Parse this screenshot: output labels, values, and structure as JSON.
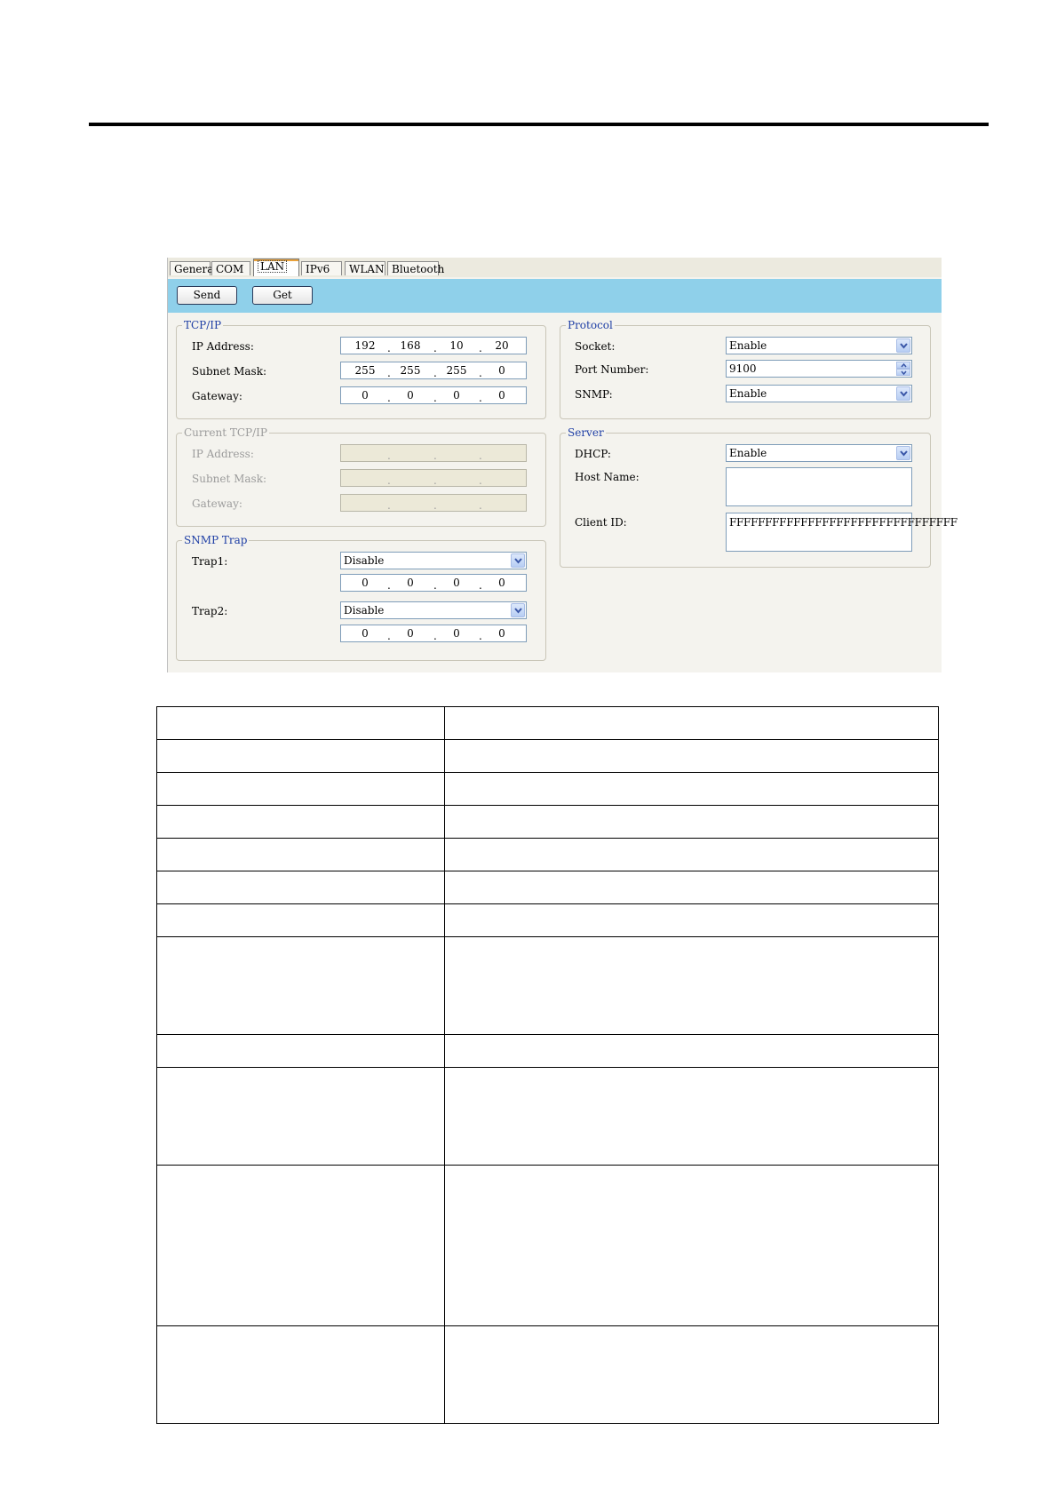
{
  "tabs": [
    {
      "label": "General",
      "active": false
    },
    {
      "label": "COM",
      "active": false
    },
    {
      "label": "LAN",
      "active": true
    },
    {
      "label": "IPv6",
      "active": false
    },
    {
      "label": "WLAN",
      "active": false
    },
    {
      "label": "Bluetooth",
      "active": false
    }
  ],
  "toolbar": {
    "send_label": "Send",
    "get_label": "Get"
  },
  "tcpip": {
    "title": "TCP/IP",
    "ip_label": "IP Address:",
    "ip": [
      "192",
      "168",
      "10",
      "20"
    ],
    "mask_label": "Subnet Mask:",
    "mask": [
      "255",
      "255",
      "255",
      "0"
    ],
    "gateway_label": "Gateway:",
    "gateway": [
      "0",
      "0",
      "0",
      "0"
    ]
  },
  "current_tcpip": {
    "title": "Current TCP/IP",
    "ip_label": "IP Address:",
    "mask_label": "Subnet Mask:",
    "gateway_label": "Gateway:"
  },
  "snmp_trap": {
    "title": "SNMP Trap",
    "trap1_label": "Trap1:",
    "trap1_value": "Disable",
    "trap1_ip": [
      "0",
      "0",
      "0",
      "0"
    ],
    "trap2_label": "Trap2:",
    "trap2_value": "Disable",
    "trap2_ip": [
      "0",
      "0",
      "0",
      "0"
    ]
  },
  "protocol": {
    "title": "Protocol",
    "socket_label": "Socket:",
    "socket_value": "Enable",
    "port_label": "Port Number:",
    "port_value": "9100",
    "snmp_label": "SNMP:",
    "snmp_value": "Enable"
  },
  "server": {
    "title": "Server",
    "dhcp_label": "DHCP:",
    "dhcp_value": "Enable",
    "host_label": "Host Name:",
    "host_value": "",
    "client_label": "Client ID:",
    "client_value": "FFFFFFFFFFFFFFFFFFFFFFFFFFFFFFFF"
  },
  "ip_separator": "."
}
